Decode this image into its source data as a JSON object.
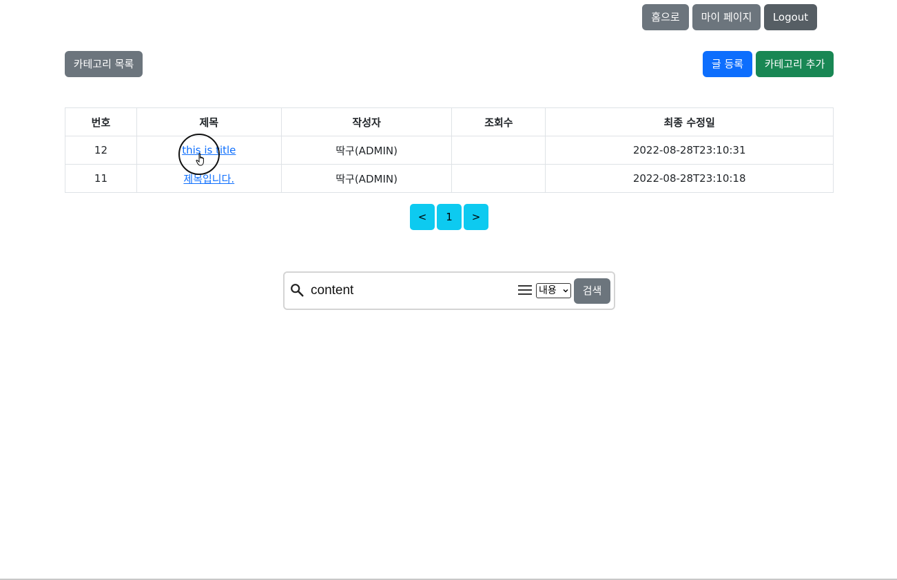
{
  "header": {
    "home_label": "홈으로",
    "mypage_label": "마이 페이지",
    "logout_label": "Logout"
  },
  "toolbar": {
    "category_list_label": "카테고리 목록",
    "write_label": "글 등록",
    "category_add_label": "카테고리 추가"
  },
  "table": {
    "columns": [
      "번호",
      "제목",
      "작성자",
      "조회수",
      "최종 수정일"
    ],
    "rows": [
      {
        "no": "12",
        "title": "this is title",
        "author": "딱구(ADMIN)",
        "views": "",
        "modified": "2022-08-28T23:10:31"
      },
      {
        "no": "11",
        "title": "제목입니다.",
        "author": "딱구(ADMIN)",
        "views": "",
        "modified": "2022-08-28T23:10:18"
      }
    ]
  },
  "pagination": {
    "prev_label": "<",
    "pages": [
      "1"
    ],
    "next_label": ">"
  },
  "search": {
    "value": "content",
    "type_selected": "내용",
    "submit_label": "검색"
  },
  "colors": {
    "secondary": "#6c757d",
    "primary": "#0d6efd",
    "success": "#198754",
    "info": "#0dcaf0"
  },
  "icons": [
    "search-icon",
    "menu-icon",
    "chevron-down-icon",
    "hand-cursor-icon"
  ]
}
